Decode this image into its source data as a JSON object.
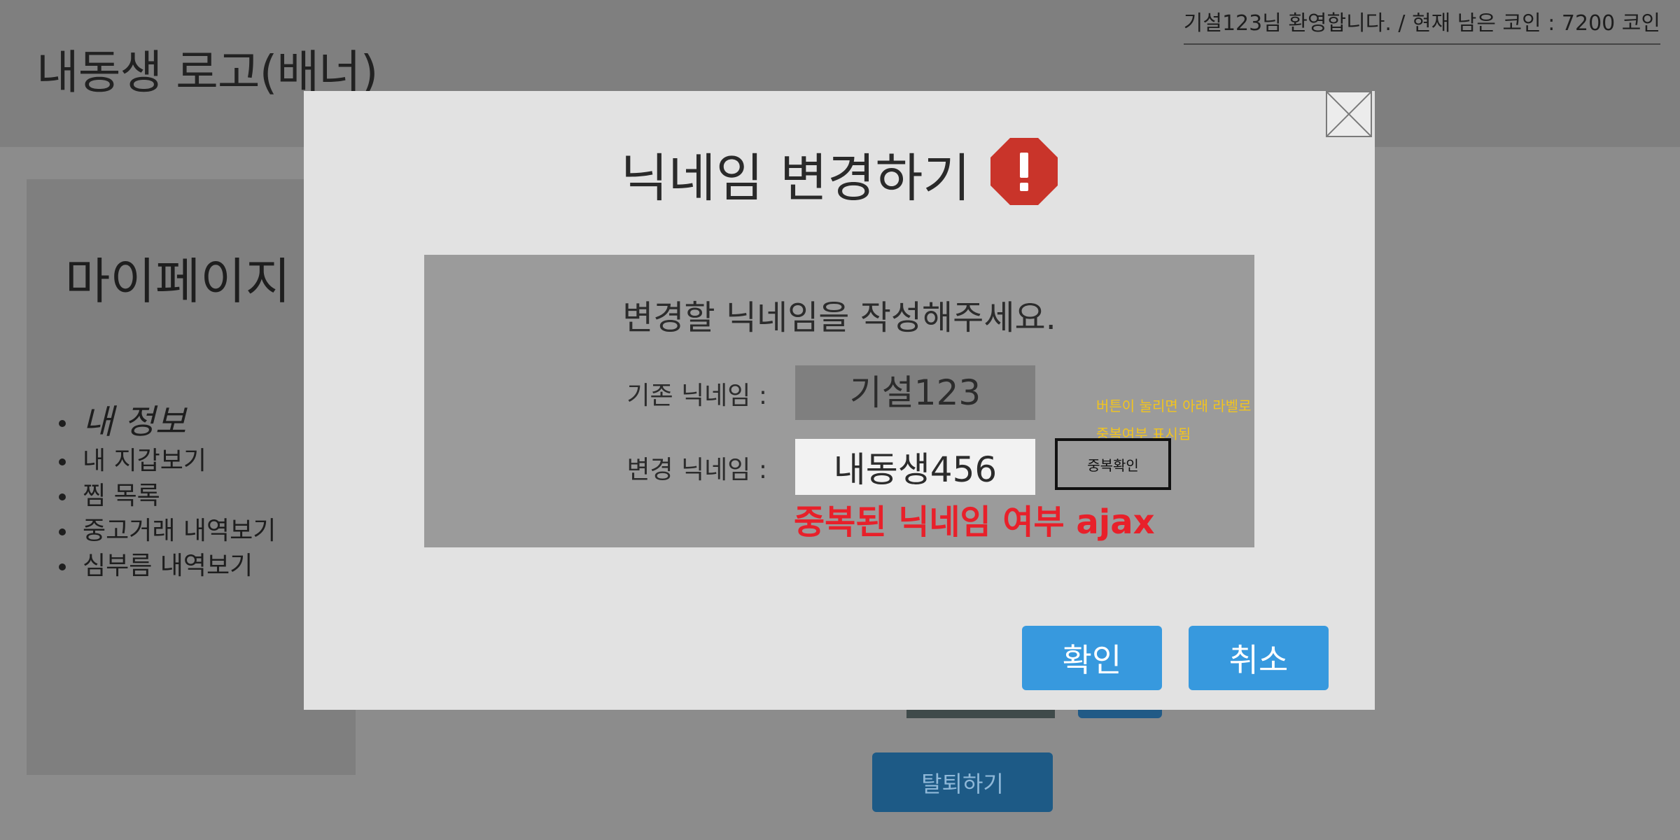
{
  "header": {
    "logo_text": "내동생 로고(배너)",
    "welcome_text": "기설123님 환영합니다.  / 현재 남은 코인 : 7200 코인"
  },
  "sidebar": {
    "title": "마이페이지",
    "items": [
      {
        "label": "내 정보"
      },
      {
        "label": "내 지갑보기"
      },
      {
        "label": "찜 목록"
      },
      {
        "label": "중고거래 내역보기"
      },
      {
        "label": "심부름 내역보기"
      }
    ]
  },
  "page": {
    "withdraw_label": "탈퇴하기"
  },
  "modal": {
    "title": "닉네임 변경하기",
    "alert_icon": "alert-octagon-icon",
    "close_icon": "close-x-icon",
    "instruction": "변경할 닉네임을 작성해주세요.",
    "current_label": "기존 닉네임 :",
    "current_value": "기설123",
    "new_label": "변경 닉네임 :",
    "new_value": "내동생456",
    "dup_button_label": "중복확인",
    "note_line1": "버튼이 눌리면 아래 라벨로",
    "note_line2": "중복여부 표시됨",
    "dup_result": "중복된 닉네임 여부 ajax",
    "confirm_label": "확인",
    "cancel_label": "취소"
  },
  "colors": {
    "accent_blue": "#3799de",
    "alert_red": "#c9342a",
    "error_red": "#e8202a",
    "note_yellow": "#f2c41e"
  }
}
